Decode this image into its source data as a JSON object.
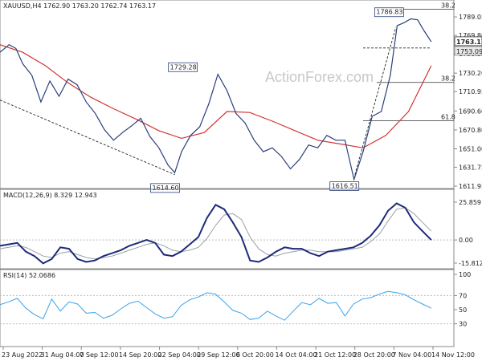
{
  "chart_data": {
    "type": "line",
    "price_panel": {
      "header": "XAUUSD,H4  1762.90 1763.20 1762.74 1763.17",
      "watermark": "ActionForex.com",
      "y_ticks": [
        1789.05,
        1769.8,
        1750.55,
        1730.2,
        1710.95,
        1690.6,
        1670.8,
        1651.0,
        1631.75,
        1611.95
      ],
      "y_range": [
        1611.95,
        1795
      ],
      "current_price": 1763.17,
      "ref_level": 1753.09,
      "annotations": [
        {
          "text": "1614.60",
          "x": 0.385,
          "y": 1614.6
        },
        {
          "text": "1729.28",
          "x": 0.41,
          "y": 1729.28
        },
        {
          "text": "1616.51",
          "x": 0.78,
          "y": 1616.51
        },
        {
          "text": "1786.83",
          "x": 0.875,
          "y": 1786.83
        }
      ],
      "fib_levels": [
        {
          "label": "38.2",
          "value": 1720.5
        },
        {
          "label": "61.8",
          "value": 1680.5
        },
        {
          "label": "38.2",
          "value": 1797.0
        }
      ],
      "series": [
        {
          "name": "Price",
          "color": "#2a3f7a",
          "x": [
            0.0,
            0.02,
            0.035,
            0.05,
            0.07,
            0.09,
            0.11,
            0.13,
            0.15,
            0.17,
            0.19,
            0.21,
            0.23,
            0.25,
            0.27,
            0.29,
            0.31,
            0.33,
            0.35,
            0.37,
            0.385,
            0.4,
            0.42,
            0.44,
            0.46,
            0.48,
            0.5,
            0.52,
            0.54,
            0.56,
            0.58,
            0.6,
            0.62,
            0.64,
            0.66,
            0.68,
            0.7,
            0.72,
            0.74,
            0.76,
            0.78,
            0.8,
            0.82,
            0.84,
            0.86,
            0.875,
            0.89,
            0.905,
            0.92,
            0.935,
            0.95
          ],
          "y": [
            1752,
            1760,
            1756,
            1740,
            1728,
            1700,
            1722,
            1706,
            1724,
            1718,
            1700,
            1688,
            1671,
            1660,
            1668,
            1675,
            1683,
            1664,
            1652,
            1634,
            1626,
            1648,
            1665,
            1674,
            1698,
            1729,
            1712,
            1688,
            1678,
            1660,
            1648,
            1652,
            1643,
            1630,
            1640,
            1655,
            1652,
            1665,
            1660,
            1660,
            1619,
            1648,
            1685,
            1690,
            1728,
            1780,
            1783,
            1787,
            1786,
            1774,
            1763
          ]
        },
        {
          "name": "MA",
          "color": "#d43333",
          "x": [
            0.0,
            0.05,
            0.1,
            0.15,
            0.2,
            0.25,
            0.3,
            0.35,
            0.4,
            0.45,
            0.5,
            0.55,
            0.6,
            0.65,
            0.7,
            0.75,
            0.8,
            0.85,
            0.9,
            0.95
          ],
          "y": [
            1760,
            1752,
            1738,
            1720,
            1705,
            1693,
            1682,
            1670,
            1662,
            1668,
            1690,
            1689,
            1680,
            1670,
            1660,
            1656,
            1652,
            1665,
            1690,
            1738
          ]
        }
      ],
      "trendlines": [
        {
          "from": [
            0.0,
            1702
          ],
          "to": [
            0.385,
            1624
          ],
          "style": "dashed"
        },
        {
          "from": [
            0.782,
            1624
          ],
          "to": [
            0.872,
            1778
          ],
          "style": "dashed"
        },
        {
          "from": [
            0.8,
            1756.5
          ],
          "to": [
            0.95,
            1756.5
          ],
          "style": "dashed"
        }
      ]
    },
    "macd_panel": {
      "header": "MACD(12,26,9) 8.329 12.943",
      "y_ticks": [
        25.859,
        0.0,
        -15.812
      ],
      "y_range": [
        -18,
        28
      ],
      "macd": [
        -4,
        -3,
        -2,
        -8,
        -11,
        -16,
        -13,
        -5,
        -6,
        -13,
        -15,
        -14,
        -11,
        -9,
        -7,
        -4,
        -2,
        0,
        -2,
        -10,
        -11,
        -8,
        -3,
        2,
        15,
        24,
        21,
        12,
        2,
        -14,
        -15,
        -12,
        -8,
        -5,
        -6,
        -6,
        -9,
        -11,
        -8,
        -7,
        -6,
        -5,
        -2,
        3,
        10,
        20,
        25,
        22,
        12,
        6,
        0
      ],
      "signal": [
        -6,
        -5,
        -4,
        -5,
        -8,
        -11,
        -12,
        -9,
        -8,
        -10,
        -12,
        -13,
        -12,
        -11,
        -9,
        -7,
        -5,
        -3,
        -2,
        -4,
        -7,
        -8,
        -7,
        -5,
        1,
        10,
        17,
        18,
        14,
        2,
        -6,
        -10,
        -11,
        -9,
        -8,
        -7,
        -7,
        -8,
        -8,
        -8,
        -7,
        -6,
        -5,
        -1,
        4,
        13,
        21,
        22,
        18,
        12,
        6
      ]
    },
    "rsi_panel": {
      "header": "RSI(14) 52.0686",
      "y_ticks": [
        100,
        70,
        50,
        30
      ],
      "y_range": [
        0,
        100
      ],
      "rsi": [
        57,
        61,
        66,
        52,
        43,
        37,
        65,
        48,
        61,
        58,
        45,
        46,
        38,
        42,
        51,
        59,
        62,
        53,
        44,
        38,
        40,
        56,
        64,
        68,
        74,
        72,
        61,
        49,
        45,
        36,
        38,
        48,
        41,
        35,
        48,
        60,
        57,
        66,
        59,
        60,
        41,
        58,
        65,
        67,
        72,
        76,
        74,
        71,
        64,
        58,
        52
      ]
    },
    "x_ticks": [
      "23 Aug 2022",
      "31 Aug 04:00",
      "7 Sep 12:00",
      "14 Sep 20:00",
      "22 Sep 04:00",
      "29 Sep 12:00",
      "6 Oct 20:00",
      "14 Oct 04:00",
      "21 Oct 12:00",
      "28 Oct 20:00",
      "7 Nov 04:00",
      "14 Nov 12:00"
    ]
  }
}
